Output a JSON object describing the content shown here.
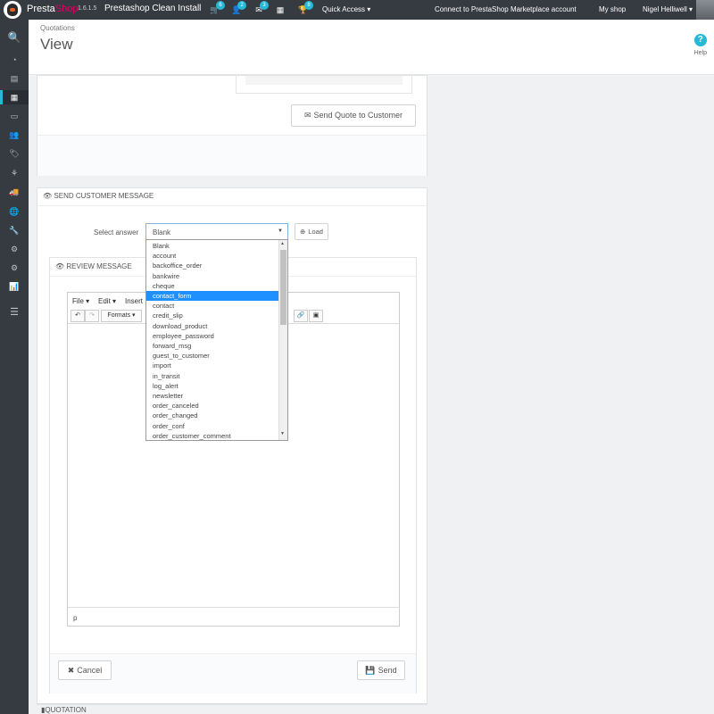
{
  "topbar": {
    "brand_a": "Presta",
    "brand_b": "Shop",
    "version": "1.6.1.5",
    "shop_name": "Prestashop Clean Install",
    "icons": [
      {
        "name": "cart-icon",
        "glyph": "🛒",
        "badge": "6"
      },
      {
        "name": "customers-icon",
        "glyph": "👤",
        "badge": "2"
      },
      {
        "name": "messages-icon",
        "glyph": "✉",
        "badge": "3"
      },
      {
        "name": "calculator-icon",
        "glyph": "▦",
        "badge": ""
      },
      {
        "name": "trophy-icon",
        "glyph": "🏆",
        "badge": "8"
      }
    ],
    "quick_access": "Quick Access ▾",
    "connect": "Connect to PrestaShop Marketplace account",
    "my_shop": "My shop",
    "user": "Nigel Helliwell ▾"
  },
  "sidebar": {
    "icons": [
      {
        "name": "search-icon",
        "glyph": "🔍"
      },
      {
        "name": "dashboard-icon",
        "glyph": "◔"
      },
      {
        "name": "orders-icon",
        "glyph": "▤"
      },
      {
        "name": "quotations-icon",
        "glyph": "▦"
      },
      {
        "name": "payment-icon",
        "glyph": "▭"
      },
      {
        "name": "customers-icon",
        "glyph": "👥"
      },
      {
        "name": "catalog-icon",
        "glyph": "🏷"
      },
      {
        "name": "modules-icon",
        "glyph": "⚘"
      },
      {
        "name": "shipping-icon",
        "glyph": "🚚"
      },
      {
        "name": "localization-icon",
        "glyph": "🌐"
      },
      {
        "name": "preferences-icon",
        "glyph": "🔧"
      },
      {
        "name": "advanced-parameters-icon",
        "glyph": "⚙"
      },
      {
        "name": "administration-icon",
        "glyph": "⚙"
      },
      {
        "name": "stats-icon",
        "glyph": "📊"
      },
      {
        "name": "menu-icon",
        "glyph": "☰"
      }
    ]
  },
  "header": {
    "breadcrumb": "Quotations",
    "title": "View",
    "help_icon": "?",
    "help_label": "Help"
  },
  "quote_panel": {
    "send_quote_icon": "✉",
    "send_quote_label": "Send Quote to Customer"
  },
  "message_panel": {
    "title": "SEND CUSTOMER MESSAGE",
    "title_icon": "👁",
    "select_label": "Select answer",
    "select_value": "Blank",
    "load_icon": "⊕",
    "load_label": "Load",
    "review_icon": "👁",
    "review_title": "REVIEW MESSAGE",
    "editor": {
      "menu_file": "File ▾",
      "menu_edit": "Edit ▾",
      "menu_insert": "Insert",
      "formats": "Formats ▾",
      "status_path": "p"
    },
    "cancel_icon": "✖",
    "cancel_label": "Cancel",
    "send_icon": "💾",
    "send_label": "Send"
  },
  "dropdown": {
    "selected_index": 5,
    "options": [
      "Blank",
      "account",
      "backoffice_order",
      "bankwire",
      "cheque",
      "contact_form",
      "contact",
      "credit_slip",
      "download_product",
      "employee_password",
      "forward_msg",
      "guest_to_customer",
      "import",
      "in_transit",
      "log_alert",
      "newsletter",
      "order_canceled",
      "order_changed",
      "order_conf",
      "order_customer_comment"
    ]
  },
  "footer_section": {
    "quotation_label": "QUOTATION"
  },
  "colors": {
    "accent": "#25b9d7",
    "brand_pink": "#df0067",
    "dark_bar": "#363a41",
    "dropdown_selected": "#1e90ff"
  }
}
